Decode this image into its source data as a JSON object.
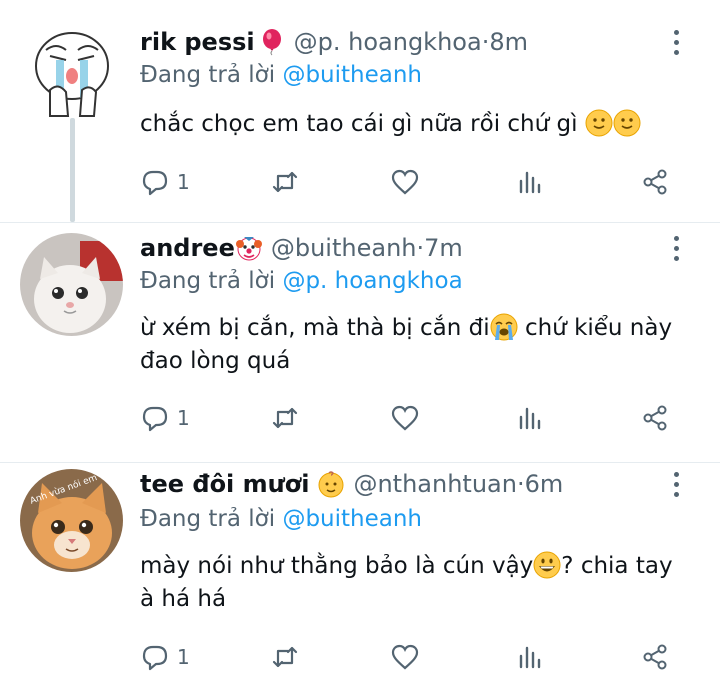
{
  "colors": {
    "accent": "#1d9bf0",
    "secondary_text": "#536471",
    "primary_text": "#0f1419"
  },
  "tweets": [
    {
      "name": "rik pessi",
      "name_emoji": "balloon",
      "handle": "@p. hoangkhoa",
      "sep": " · ",
      "time": "8m",
      "reply_prefix": "Đang trả lời ",
      "reply_to": "@buitheanh",
      "text_parts": [
        "chắc chọc em tao cái gì nữa rồi chứ gì "
      ],
      "text_emojis": [
        "slight-smile",
        "slight-smile"
      ],
      "reply_count": "1"
    },
    {
      "name": "andree",
      "name_emoji": "clown",
      "handle": "@buitheanh",
      "sep": " · ",
      "time": "7m",
      "reply_prefix": "Đang trả lời ",
      "reply_to": "@p. hoangkhoa",
      "text_parts": [
        "ừ xém bị cắn, mà thà bị cắn đi",
        " chứ kiểu này đao lòng quá"
      ],
      "text_emojis": [
        "loudly-crying"
      ],
      "reply_count": "1"
    },
    {
      "name": "tee đôi mươi",
      "name_emoji": "baby",
      "handle": "@nthanhtuan",
      "sep": " · ",
      "time": "6m",
      "reply_prefix": "Đang trả lời ",
      "reply_to": "@buitheanh",
      "text_parts": [
        "mày nói như thằng bảo là cún vậy",
        "? chia tay à há há"
      ],
      "text_emojis": [
        "grinning"
      ],
      "avatar_caption": "Anh vừa nói em hả",
      "reply_count": "1"
    }
  ]
}
